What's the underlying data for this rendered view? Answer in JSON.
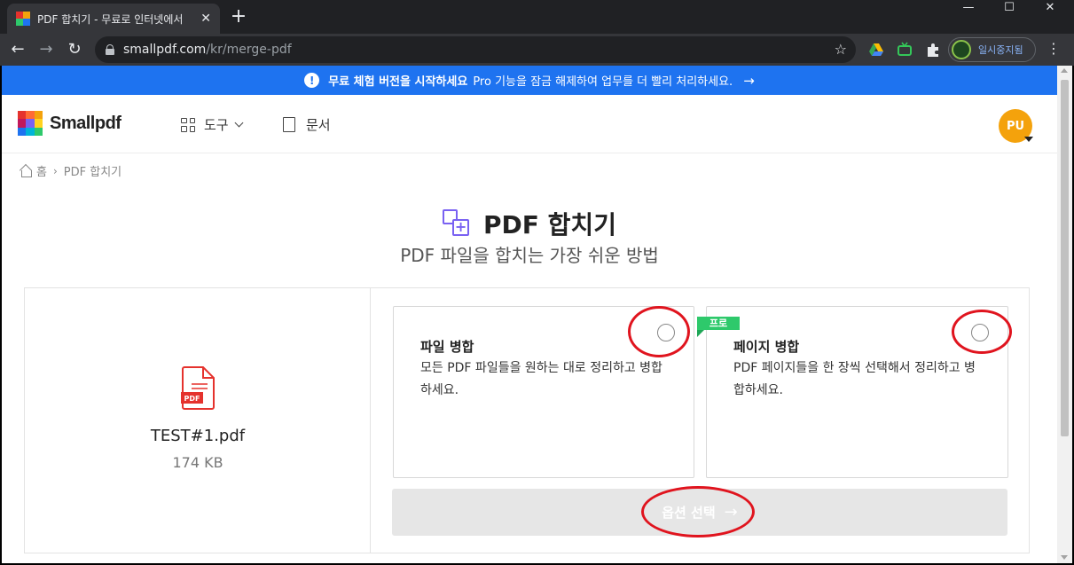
{
  "browser": {
    "tab_title": "PDF 합치기 - 무료로 인터넷에서",
    "tab_close": "✕",
    "new_tab": "+",
    "url_host": "smallpdf.com",
    "url_path": "/kr/merge-pdf",
    "profile_label": "일시중지됨",
    "window_minimize": "—",
    "window_maximize": "☐",
    "window_close": "✕"
  },
  "banner": {
    "strong": "무료 체험 버전을 시작하세요",
    "text": "Pro 기능을 잠금 해제하여 업무를 더 빨리 처리하세요.",
    "arrow": "→"
  },
  "header": {
    "logo_text": "Smallpdf",
    "nav_tools": "도구",
    "nav_documents": "문서",
    "avatar_initials": "PU"
  },
  "breadcrumb": {
    "home": "홈",
    "separator": "›",
    "current": "PDF 합치기"
  },
  "page": {
    "title": "PDF 합치기",
    "subtitle": "PDF 파일을 합치는 가장 쉬운 방법"
  },
  "file": {
    "name": "TEST#1.pdf",
    "size": "174 KB",
    "badge": "PDF"
  },
  "options": [
    {
      "title": "파일 병합",
      "description": "모든 PDF 파일들을 원하는 대로 정리하고 병합하세요."
    },
    {
      "title": "페이지 병합",
      "description": "PDF 페이지들을 한 장씩 선택해서 정리하고 병합하세요.",
      "badge": "프로"
    }
  ],
  "action": {
    "label": "옵션 선택",
    "arrow": "→"
  },
  "colors": {
    "banner": "#1e73f0",
    "accent_purple": "#7961f2",
    "pro_green": "#2ec96b",
    "avatar_orange": "#f4a20c",
    "annotation_red": "#e0141e",
    "pdf_red": "#e5322d"
  }
}
